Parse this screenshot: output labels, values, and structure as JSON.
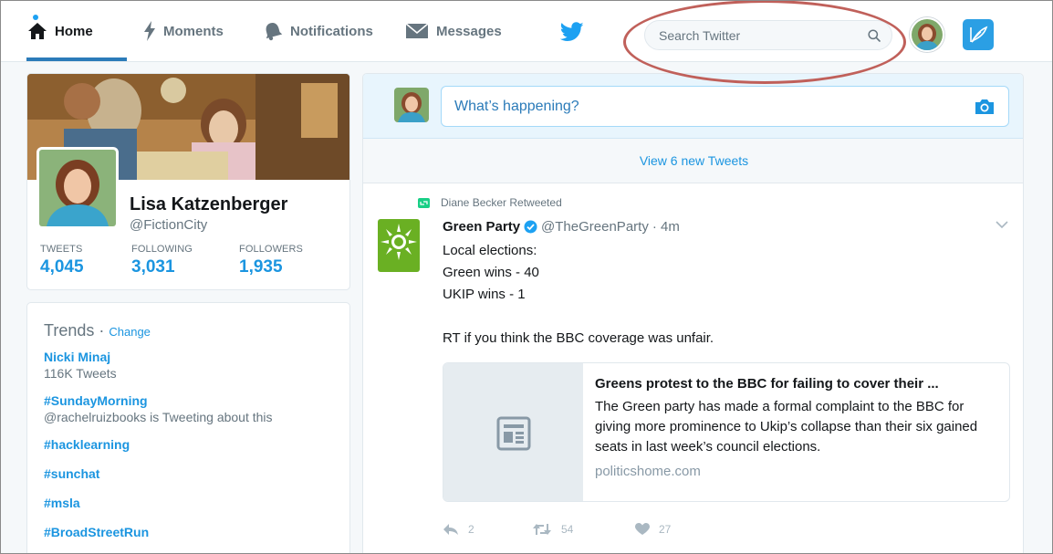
{
  "nav": {
    "home": "Home",
    "moments": "Moments",
    "notifications": "Notifications",
    "messages": "Messages",
    "search_placeholder": "Search Twitter",
    "colors": {
      "accent": "#1da1f2",
      "home_underline": "#2b7bb9",
      "tweet_button": "#2b9fe4",
      "highlight": "#c0605a"
    }
  },
  "profile": {
    "name": "Lisa Katzenberger",
    "handle": "@FictionCity",
    "stats": [
      {
        "label": "Tweets",
        "value": "4,045"
      },
      {
        "label": "Following",
        "value": "3,031"
      },
      {
        "label": "Followers",
        "value": "1,935"
      }
    ]
  },
  "trends": {
    "title": "Trends",
    "change": "Change",
    "items": [
      {
        "name": "Nicki Minaj",
        "meta": "116K Tweets"
      },
      {
        "name": "#SundayMorning",
        "meta": "@rachelruizbooks is Tweeting about this"
      },
      {
        "name": "#hacklearning",
        "meta": ""
      },
      {
        "name": "#sunchat",
        "meta": ""
      },
      {
        "name": "#msla",
        "meta": ""
      },
      {
        "name": "#BroadStreetRun",
        "meta": ""
      }
    ]
  },
  "composer": {
    "placeholder": "What’s happening?"
  },
  "timeline": {
    "new_tweets": "View 6 new Tweets"
  },
  "tweet": {
    "retweeted_by": "Diane Becker Retweeted",
    "name": "Green Party",
    "handle": "@TheGreenParty",
    "time": "· 4m",
    "lines": [
      "Local elections:",
      "Green wins - 40",
      "UKIP wins - 1",
      "",
      "RT if you think the BBC coverage was unfair."
    ],
    "card": {
      "title": "Greens protest to the BBC for failing to cover their ...",
      "description": "The Green party has made a formal complaint to the BBC for giving more prominence to Ukip’s collapse than their six gained seats in last week’s council elections.",
      "domain": "politicshome.com"
    },
    "actions": {
      "replies": "2",
      "retweets": "54",
      "likes": "27"
    }
  }
}
